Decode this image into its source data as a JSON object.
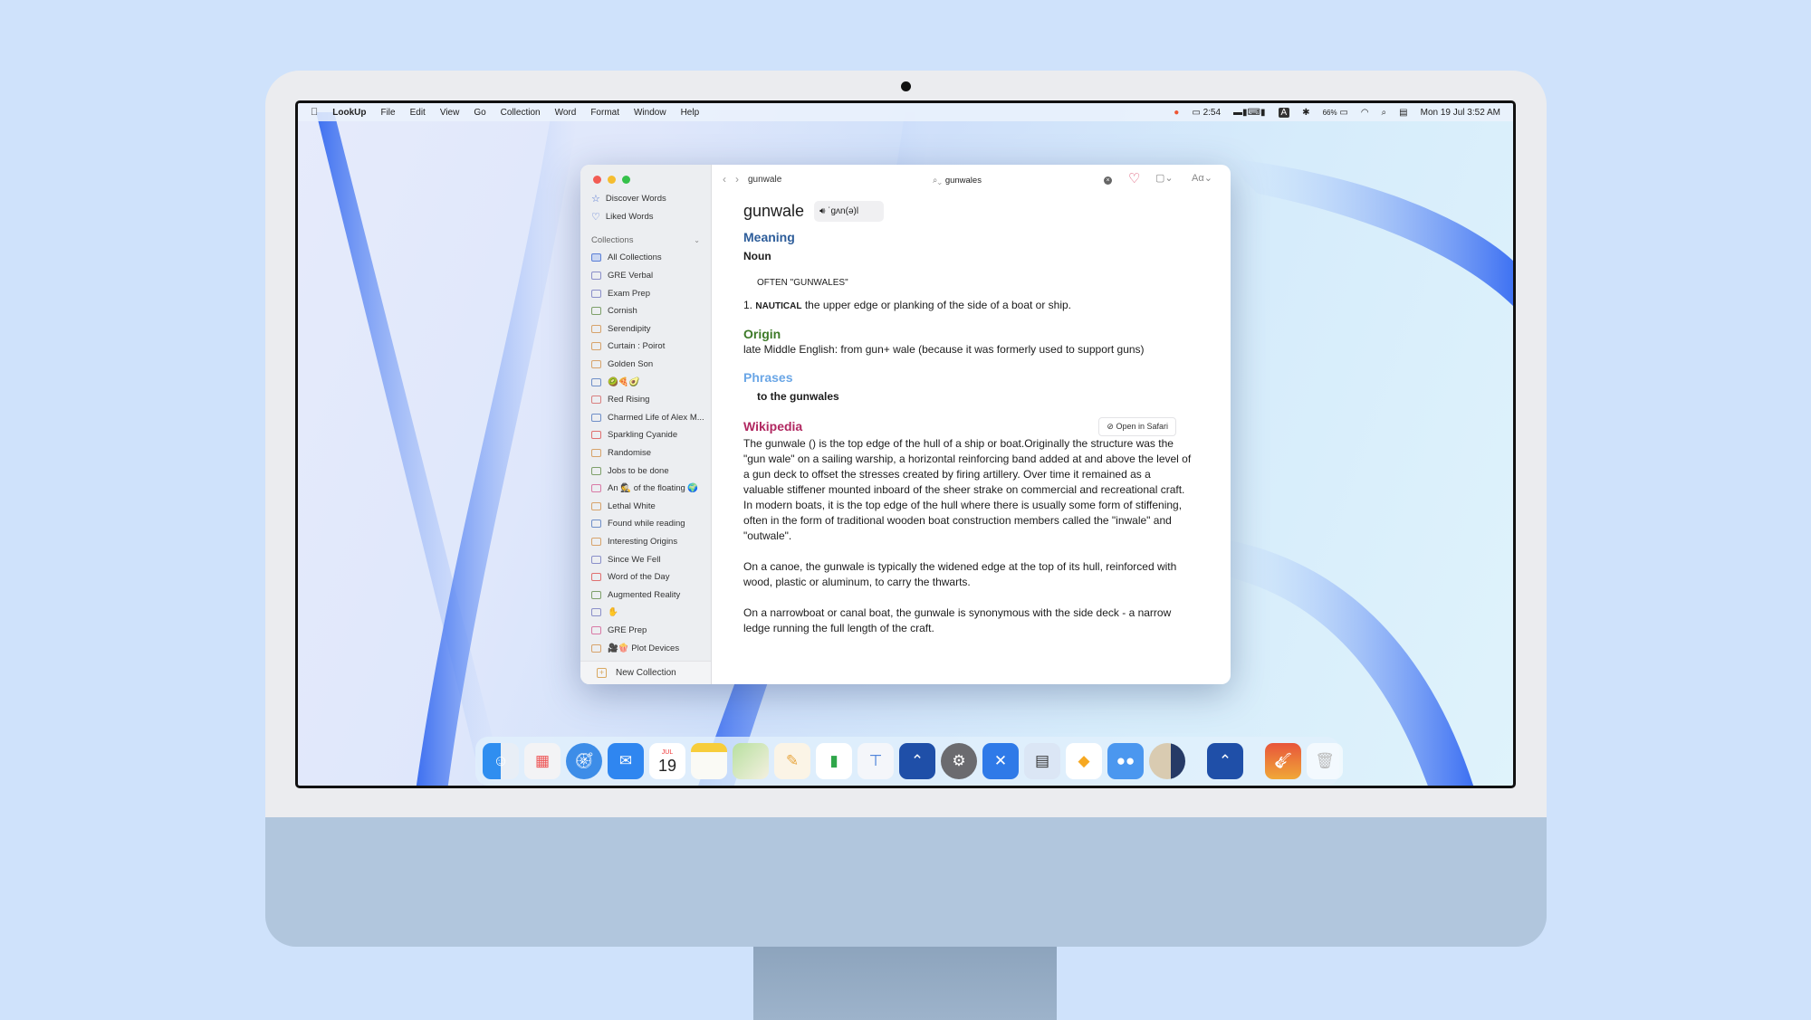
{
  "menubar": {
    "apple": "",
    "app_name": "LookUp",
    "menus": [
      "File",
      "Edit",
      "View",
      "Go",
      "Collection",
      "Word",
      "Format",
      "Window",
      "Help"
    ],
    "status": {
      "battery_time": "2:54",
      "input_source": "A",
      "battery_percent": "66%",
      "datetime": "Mon 19 Jul  3:52 AM"
    }
  },
  "sidebar": {
    "top_items": [
      {
        "label": "Discover Words",
        "icon": "star-icon"
      },
      {
        "label": "Liked Words",
        "icon": "heart-icon"
      }
    ],
    "collections_header": "Collections",
    "collections": [
      {
        "label": "All Collections",
        "color": "#5b7fd6"
      },
      {
        "label": "GRE Verbal",
        "color": "#8a8fc9"
      },
      {
        "label": "Exam Prep",
        "color": "#8a8fc9"
      },
      {
        "label": "Cornish",
        "color": "#7ea06a"
      },
      {
        "label": "Serendipity",
        "color": "#d7a36b"
      },
      {
        "label": "Curtain : Poirot",
        "color": "#d7a36b"
      },
      {
        "label": "Golden Son",
        "color": "#d7a36b"
      },
      {
        "label": "🥝🍕🥑",
        "color": "#6f8fc8"
      },
      {
        "label": "Red Rising",
        "color": "#d98080"
      },
      {
        "label": "Charmed Life of Alex M...",
        "color": "#6f8fc8"
      },
      {
        "label": "Sparkling Cyanide",
        "color": "#e07070"
      },
      {
        "label": "Randomise",
        "color": "#d7a36b"
      },
      {
        "label": "Jobs to be done",
        "color": "#7ea06a"
      },
      {
        "label": "An 🕵️ of the floating 🌍",
        "color": "#d97aa6"
      },
      {
        "label": "Lethal White",
        "color": "#d7a36b"
      },
      {
        "label": "Found while reading",
        "color": "#6f8fc8"
      },
      {
        "label": "Interesting Origins",
        "color": "#d7a36b"
      },
      {
        "label": "Since We Fell",
        "color": "#8a8fc9"
      },
      {
        "label": "Word of the Day",
        "color": "#e07070"
      },
      {
        "label": "Augmented Reality",
        "color": "#7ea06a"
      },
      {
        "label": "✋",
        "color": "#8a8fc9"
      },
      {
        "label": "GRE Prep",
        "color": "#d97aa6"
      },
      {
        "label": "🎥🍿 Plot Devices",
        "color": "#d7a36b"
      }
    ],
    "new_collection": "New Collection"
  },
  "toolbar": {
    "title": "gunwale",
    "search_value": "gunwales"
  },
  "entry": {
    "word": "gunwale",
    "pronunciation": "ˈɡʌn(ə)l",
    "meaning_heading": "Meaning",
    "part_of_speech": "Noun",
    "note": "OFTEN \"GUNWALES\"",
    "definition_number": "1.",
    "definition_label": "NAUTICAL",
    "definition": "the upper edge or planking of the side of a boat or ship.",
    "origin_heading": "Origin",
    "origin": "late Middle English: from gun+ wale (because it was formerly used to support guns)",
    "phrases_heading": "Phrases",
    "phrase": "to the gunwales",
    "wikipedia_heading": "Wikipedia",
    "open_in_safari": "Open in Safari",
    "wiki_paragraphs": [
      "The gunwale () is the top edge of the hull of a ship or boat.Originally the structure was the \"gun wale\" on a sailing warship, a horizontal reinforcing band added at and above the level of a gun deck to offset the stresses created by firing artillery. Over time it remained as a valuable stiffener mounted inboard of the sheer strake on commercial and recreational craft. In modern boats, it is the top edge of the hull where there is usually some form of stiffening, often in the form of traditional wooden boat construction members called the \"inwale\" and \"outwale\".",
      "On a canoe, the gunwale is typically the widened edge at the top of its hull, reinforced with wood, plastic or aluminum, to carry the thwarts.",
      "On a narrowboat or canal boat, the gunwale is synonymous with the side deck - a narrow ledge running the full length of the craft."
    ]
  },
  "dock": {
    "calendar_month": "JUL",
    "calendar_day": "19",
    "apps": [
      "Finder",
      "Launchpad",
      "Safari",
      "Mail",
      "Calendar",
      "Notes",
      "Maps",
      "Pages",
      "Numbers",
      "Keynote",
      "LookUp",
      "System Preferences",
      "Xcode",
      "Preview",
      "Sketch",
      "Tweetbot",
      "Moon",
      "LookUp",
      "GarageBand",
      "Trash"
    ]
  }
}
